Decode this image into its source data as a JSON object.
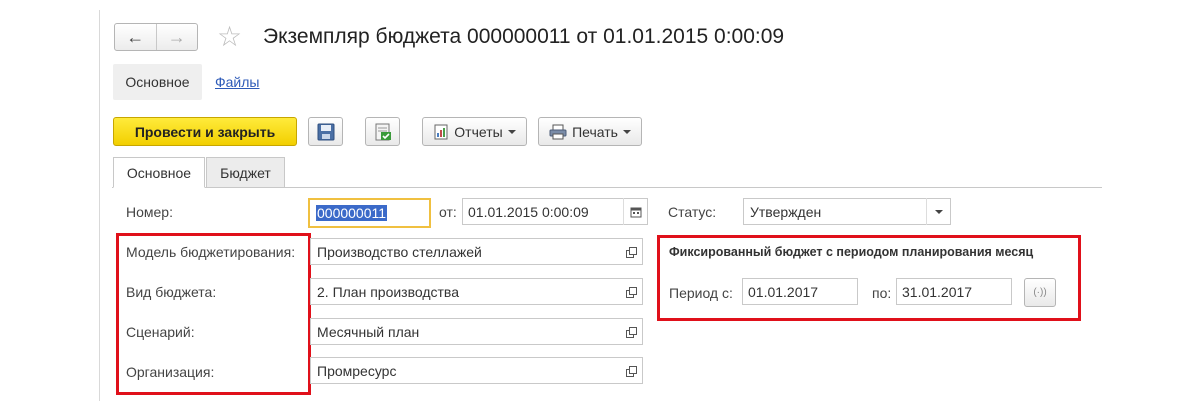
{
  "window": {
    "title": "Экземпляр бюджета 000000011 от 01.01.2015 0:00:09"
  },
  "nav": {
    "back_icon": "←",
    "forward_icon": "→",
    "favorite_icon": "☆"
  },
  "sections": {
    "main": "Основное",
    "files": "Файлы"
  },
  "toolbar": {
    "post_close": "Провести и закрыть",
    "reports": "Отчеты",
    "print": "Печать"
  },
  "tabs": [
    {
      "label": "Основное",
      "active": true
    },
    {
      "label": "Бюджет",
      "active": false
    }
  ],
  "form": {
    "number_label": "Номер:",
    "number_value": "000000011",
    "date_label": "от:",
    "date_value": "01.01.2015  0:00:09",
    "status_label": "Статус:",
    "status_value": "Утвержден",
    "model_label": "Модель бюджетирования:",
    "model_value": "Производство стеллажей",
    "type_label": "Вид бюджета:",
    "type_value": "2. План производства",
    "scenario_label": "Сценарий:",
    "scenario_value": "Месячный план",
    "org_label": "Организация:",
    "org_value": "Промресурс"
  },
  "period": {
    "heading": "Фиксированный бюджет с периодом планирования месяц",
    "from_label": "Период с:",
    "from_value": "01.01.2017",
    "to_label": "по:",
    "to_value": "31.01.2017",
    "pick_icon": "(·))"
  },
  "colors": {
    "primary_button": "#f5d800",
    "highlight_red": "#e0101a",
    "focus_border": "#f0c040",
    "link": "#2d5ab8",
    "selection": "#3b6ac9"
  }
}
